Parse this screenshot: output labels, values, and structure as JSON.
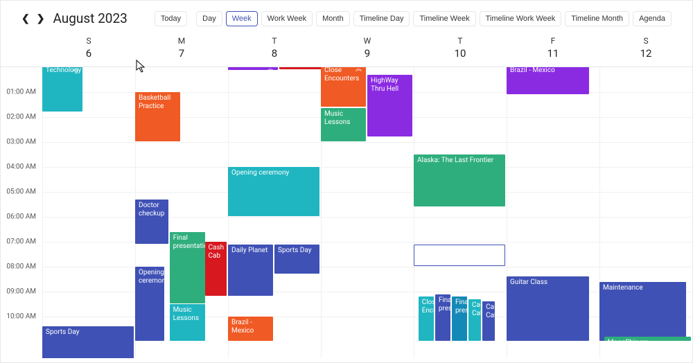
{
  "header": {
    "title": "August 2023",
    "today_label": "Today"
  },
  "views": [
    {
      "key": "day",
      "label": "Day",
      "active": false
    },
    {
      "key": "week",
      "label": "Week",
      "active": true
    },
    {
      "key": "workweek",
      "label": "Work Week",
      "active": false
    },
    {
      "key": "month",
      "label": "Month",
      "active": false
    },
    {
      "key": "tlday",
      "label": "Timeline Day",
      "active": false
    },
    {
      "key": "tlweek",
      "label": "Timeline Week",
      "active": false
    },
    {
      "key": "tlww",
      "label": "Timeline Work Week",
      "active": false
    },
    {
      "key": "tlmonth",
      "label": "Timeline Month",
      "active": false
    },
    {
      "key": "agenda",
      "label": "Agenda",
      "active": false
    }
  ],
  "days": [
    {
      "letter": "S",
      "num": "6"
    },
    {
      "letter": "M",
      "num": "7"
    },
    {
      "letter": "T",
      "num": "8"
    },
    {
      "letter": "W",
      "num": "9"
    },
    {
      "letter": "T",
      "num": "10"
    },
    {
      "letter": "F",
      "num": "11"
    },
    {
      "letter": "S",
      "num": "12"
    }
  ],
  "hours": [
    "01:00 AM",
    "02:00 AM",
    "03:00 AM",
    "04:00 AM",
    "05:00 AM",
    "06:00 AM",
    "07:00 AM",
    "08:00 AM",
    "09:00 AM",
    "10:00 AM"
  ],
  "hour_height": 36,
  "colors": {
    "teal": "#1fb6c1",
    "orange": "#f05a24",
    "purple": "#8a2be2",
    "green": "#2fae7d",
    "indigo": "#3f51b5",
    "red": "#d7181f",
    "darkteal": "#1489b8"
  },
  "events": [
    {
      "day": 0,
      "start": -0.1,
      "end": 1.8,
      "title": "Technology",
      "color": "teal",
      "chev": true,
      "width": 0.45,
      "left": 0
    },
    {
      "day": 0,
      "start": 10.4,
      "end": 12,
      "title": "Sports Day",
      "color": "indigo",
      "width": 1,
      "left": 0
    },
    {
      "day": 1,
      "start": 1,
      "end": 3,
      "title": "Basketball Practice",
      "color": "orange",
      "width": 0.5,
      "left": 0
    },
    {
      "day": 1,
      "start": 5.3,
      "end": 7.1,
      "title": "Doctor checkup",
      "color": "indigo",
      "width": 0.37,
      "left": 0
    },
    {
      "day": 1,
      "start": 8,
      "end": 11,
      "title": "Opening ceremony",
      "color": "indigo",
      "width": 0.33,
      "left": 0
    },
    {
      "day": 1,
      "start": 6.6,
      "end": 9.5,
      "title": "Final presentation",
      "color": "green",
      "width": 0.4,
      "left": 0.37
    },
    {
      "day": 1,
      "start": 9.5,
      "end": 11,
      "title": "Music Lessons",
      "color": "teal",
      "width": 0.4,
      "left": 0.37
    },
    {
      "day": 1,
      "start": 7,
      "end": 9.2,
      "title": "Cash Cab",
      "color": "red",
      "width": 0.25,
      "left": 0.75
    },
    {
      "day": 2,
      "start": -0.1,
      "end": 0.15,
      "title": "",
      "color": "purple",
      "chev": true,
      "width": 0.55,
      "left": 0
    },
    {
      "day": 2,
      "start": -0.1,
      "end": 0.1,
      "title": "",
      "color": "red",
      "width": 0.5,
      "left": 0.55
    },
    {
      "day": 2,
      "start": 4,
      "end": 6,
      "title": "Opening ceremony",
      "color": "teal",
      "width": 1,
      "left": 0
    },
    {
      "day": 2,
      "start": 7.1,
      "end": 9.2,
      "title": "Daily Planet",
      "color": "indigo",
      "width": 0.5,
      "left": 0
    },
    {
      "day": 2,
      "start": 10,
      "end": 11,
      "title": "Brazil - Mexico",
      "color": "orange",
      "width": 0.5,
      "left": 0
    },
    {
      "day": 2,
      "start": 7.1,
      "end": 8.3,
      "title": "Sports Day",
      "color": "indigo",
      "width": 0.5,
      "left": 0.5
    },
    {
      "day": 3,
      "start": -0.1,
      "end": 1.6,
      "title": "Close Encounters",
      "color": "orange",
      "chev": true,
      "width": 0.5,
      "left": 0
    },
    {
      "day": 3,
      "start": 1.65,
      "end": 3,
      "title": "Music Lessons",
      "color": "green",
      "width": 0.5,
      "left": 0
    },
    {
      "day": 3,
      "start": 0.3,
      "end": 2.8,
      "title": "HighWay Thru Hell",
      "color": "purple",
      "width": 0.5,
      "left": 0.5
    },
    {
      "day": 4,
      "start": 3.5,
      "end": 5.6,
      "title": "Alaska: The Last Frontier",
      "color": "green",
      "width": 1,
      "left": 0
    },
    {
      "day": 4,
      "start": 7.1,
      "end": 8,
      "title": "",
      "color": "white",
      "selected": true,
      "width": 1,
      "left": 0
    },
    {
      "day": 4,
      "start": 9.2,
      "end": 11,
      "title": "Close Encounters",
      "color": "teal",
      "width": 0.18,
      "left": 0.05
    },
    {
      "day": 4,
      "start": 9.1,
      "end": 11,
      "title": "Final presentation",
      "color": "indigo",
      "width": 0.18,
      "left": 0.23
    },
    {
      "day": 4,
      "start": 9.2,
      "end": 11,
      "title": "Final presentation",
      "color": "darkteal",
      "width": 0.18,
      "left": 0.41
    },
    {
      "day": 4,
      "start": 9.3,
      "end": 11,
      "title": "Cash Cab",
      "color": "teal",
      "width": 0.15,
      "left": 0.59
    },
    {
      "day": 4,
      "start": 9.4,
      "end": 11,
      "title": "Cash Cab",
      "color": "indigo",
      "width": 0.15,
      "left": 0.74
    },
    {
      "day": 5,
      "start": -0.1,
      "end": 1.1,
      "title": "Brazil - Mexico",
      "color": "purple",
      "width": 0.9,
      "left": 0
    },
    {
      "day": 5,
      "start": 8.4,
      "end": 11,
      "title": "Guitar Class",
      "color": "indigo",
      "width": 0.9,
      "left": 0
    },
    {
      "day": 6,
      "start": 8.6,
      "end": 11,
      "title": "Maintenance",
      "color": "indigo",
      "width": 0.95,
      "left": 0
    },
    {
      "day": 6,
      "start": 10.8,
      "end": 11,
      "title": "MoonShiners",
      "color": "green",
      "width": 0.95,
      "left": 0.05
    }
  ]
}
